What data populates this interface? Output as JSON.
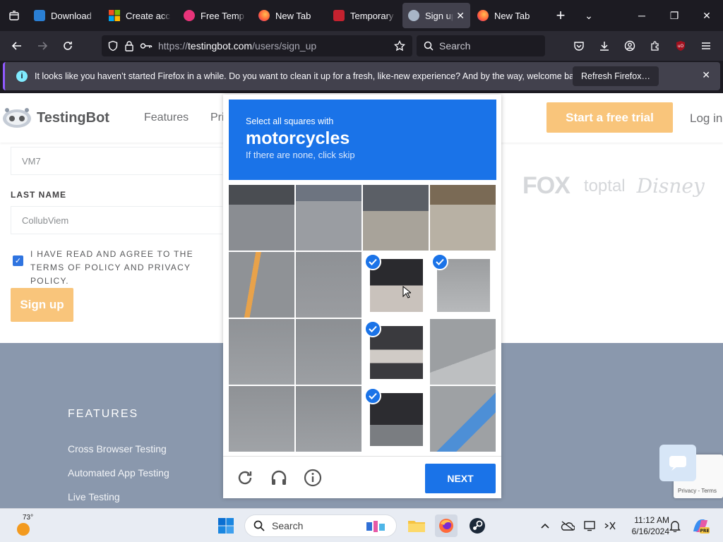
{
  "browser": {
    "tabs": [
      {
        "title": "Download",
        "active": false
      },
      {
        "title": "Create acc",
        "active": false
      },
      {
        "title": "Free Temp",
        "active": false
      },
      {
        "title": "New Tab",
        "active": false
      },
      {
        "title": "Temporary",
        "active": false
      },
      {
        "title": "Sign up",
        "active": true
      },
      {
        "title": "New Tab",
        "active": false
      }
    ],
    "url": {
      "scheme": "https://",
      "host": "testingbot.com",
      "path": "/users/sign_up"
    },
    "search_placeholder": "Search",
    "notification": {
      "message": "It looks like you haven’t started Firefox in a while. Do you want to clean it up for a fresh, like-new experience? And by the way, welcome back!",
      "button": "Refresh Firefox…"
    }
  },
  "site": {
    "logo": "TestingBot",
    "nav": [
      "Features",
      "Pri"
    ],
    "cta": "Start a free trial",
    "login": "Log in",
    "form": {
      "first_name_value": "VM7",
      "last_name_label": "LAST NAME",
      "last_name_value": "CollubViem",
      "terms": "I HAVE READ AND AGREE TO THE TERMS OF POLICY AND PRIVACY POLICY.",
      "signup": "Sign up"
    },
    "brands": [
      "FOX",
      "toptal",
      "Disney"
    ],
    "footer": {
      "heading": "FEATURES",
      "links": [
        "Cross Browser Testing",
        "Automated App Testing",
        "Live Testing"
      ]
    }
  },
  "captcha": {
    "instruction": "Select all squares with",
    "target": "motorcycles",
    "hint": "If there are none, click skip",
    "selected": [
      [
        1,
        2
      ],
      [
        1,
        3
      ],
      [
        2,
        2
      ],
      [
        3,
        2
      ]
    ],
    "next": "NEXT"
  },
  "recaptcha_badge": "Privacy - Terms",
  "taskbar": {
    "weather_temp": "73°",
    "search": "Search",
    "time": "11:12 AM",
    "date": "6/16/2024"
  }
}
